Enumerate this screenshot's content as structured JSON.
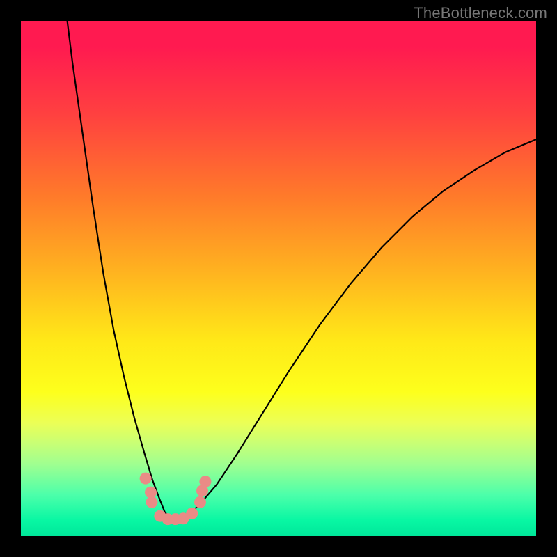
{
  "watermark": "TheBottleneck.com",
  "chart_data": {
    "type": "line",
    "title": "",
    "xlabel": "",
    "ylabel": "",
    "xlim": [
      0,
      100
    ],
    "ylim": [
      0,
      100
    ],
    "series": [
      {
        "name": "bottleneck-curve",
        "style": "black-thin",
        "x": [
          9,
          10,
          12,
          14,
          16,
          18,
          20,
          22,
          24,
          25.5,
          27,
          28,
          29.5,
          31,
          33,
          35,
          38,
          42,
          47,
          52,
          58,
          64,
          70,
          76,
          82,
          88,
          94,
          100
        ],
        "y": [
          100,
          92,
          78,
          64,
          51,
          40,
          31,
          23,
          16,
          11,
          7,
          4.5,
          3.5,
          3.5,
          4.5,
          6.5,
          10,
          16,
          24,
          32,
          41,
          49,
          56,
          62,
          67,
          71,
          74.5,
          77
        ]
      },
      {
        "name": "marker-dots",
        "style": "salmon-dots",
        "points": [
          {
            "x": 24.2,
            "y": 11.2
          },
          {
            "x": 25.2,
            "y": 8.5
          },
          {
            "x": 25.4,
            "y": 6.6
          },
          {
            "x": 27.0,
            "y": 3.9
          },
          {
            "x": 28.5,
            "y": 3.3
          },
          {
            "x": 30.0,
            "y": 3.3
          },
          {
            "x": 31.5,
            "y": 3.4
          },
          {
            "x": 33.2,
            "y": 4.4
          },
          {
            "x": 34.8,
            "y": 6.6
          },
          {
            "x": 35.2,
            "y": 8.8
          },
          {
            "x": 35.8,
            "y": 10.6
          }
        ]
      }
    ]
  }
}
